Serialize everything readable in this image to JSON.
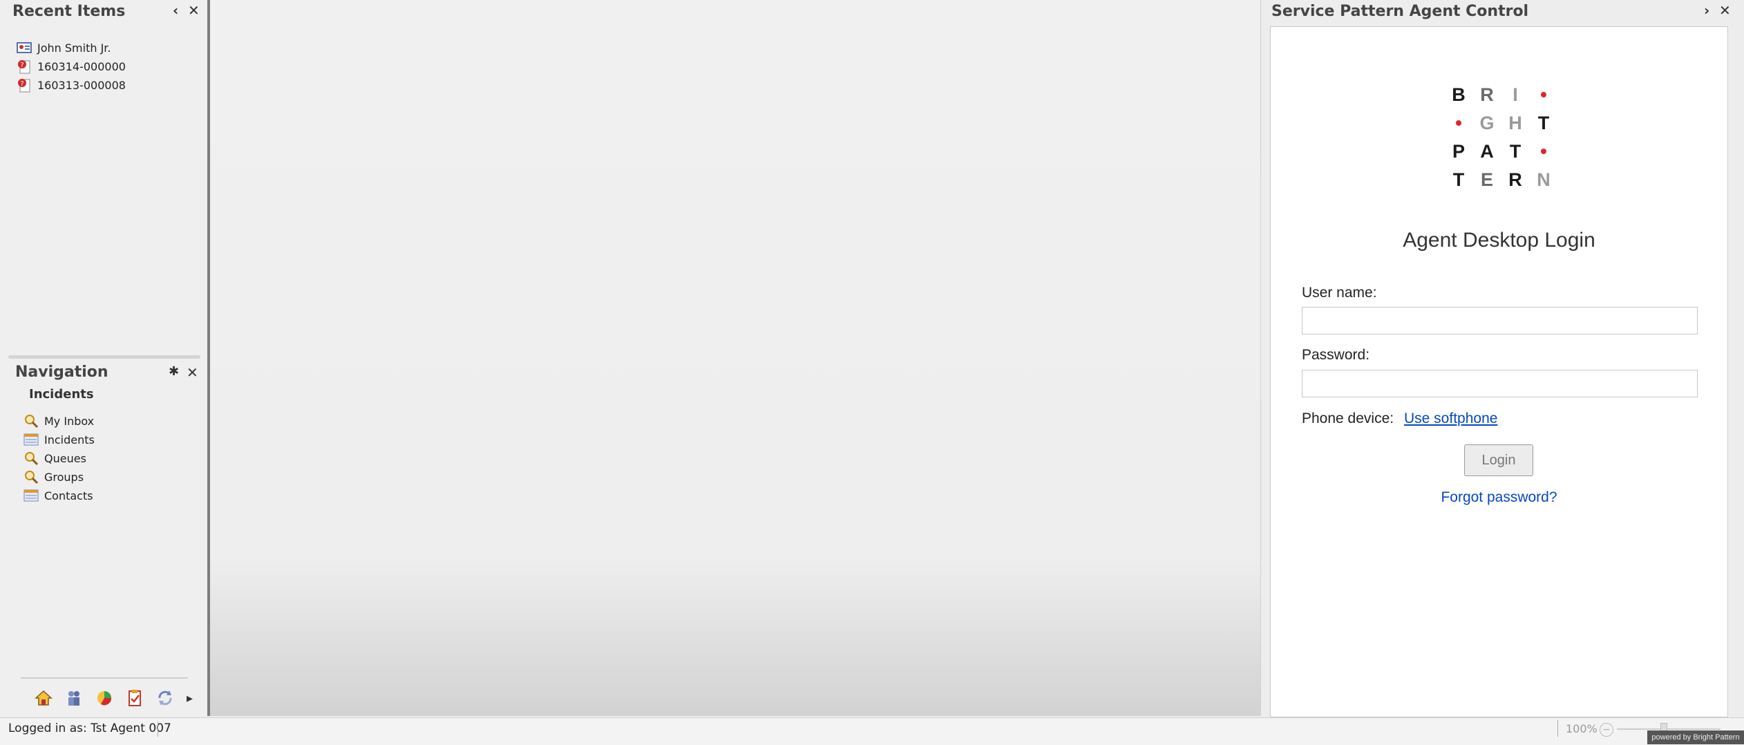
{
  "recent_items": {
    "title": "Recent Items",
    "items": [
      {
        "label": "John Smith Jr.",
        "icon": "contact-card-icon"
      },
      {
        "label": "160314-000000",
        "icon": "incident-icon"
      },
      {
        "label": "160313-000008",
        "icon": "incident-icon"
      }
    ]
  },
  "navigation": {
    "title": "Navigation",
    "section": "Incidents",
    "items": [
      {
        "label": "My Inbox",
        "icon": "magnifier-icon"
      },
      {
        "label": "Incidents",
        "icon": "report-icon"
      },
      {
        "label": "Queues",
        "icon": "magnifier-icon"
      },
      {
        "label": "Groups",
        "icon": "magnifier-icon"
      },
      {
        "label": "Contacts",
        "icon": "report-icon"
      }
    ]
  },
  "agent_control": {
    "title": "Service Pattern Agent Control",
    "heading": "Agent Desktop Login",
    "username_label": "User name:",
    "password_label": "Password:",
    "phone_label": "Phone device:",
    "softphone_link": "Use softphone",
    "login_button": "Login",
    "forgot_link": "Forgot password?",
    "logo": {
      "rows": [
        [
          "B",
          "R",
          "I",
          "•"
        ],
        [
          "•",
          "G",
          "H",
          "T"
        ],
        [
          "P",
          "A",
          "T",
          "•"
        ],
        [
          "T",
          "E",
          "R",
          "N"
        ]
      ]
    }
  },
  "status_bar": {
    "logged_in": "Logged in as: Tst Agent 007",
    "zoom": "100%",
    "powered": "powered by Bright Pattern"
  },
  "colors": {
    "accent_red": "#e0252b",
    "link_blue": "#0645c8"
  }
}
